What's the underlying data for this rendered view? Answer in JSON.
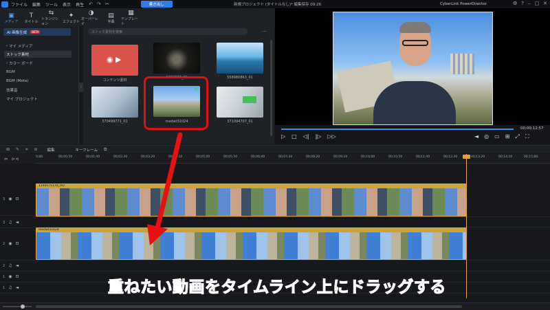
{
  "menubar": {
    "menus": [
      "ファイル",
      "編集",
      "ツール",
      "表示",
      "再生"
    ],
    "toolbar_icons": [
      "undo-icon",
      "redo-icon",
      "cut-icon"
    ],
    "export_label": "書き出し",
    "project_title": "新規プロジェクト (タイトルなし)* 編集保存 09:26",
    "product_name": "CyberLink PowerDirector"
  },
  "ribbon": {
    "tabs": [
      {
        "label": "メディア",
        "icon": "▣"
      },
      {
        "label": "タイトル",
        "icon": "T"
      },
      {
        "label": "トランジション",
        "icon": "⇆"
      },
      {
        "label": "エフェクト",
        "icon": "✦"
      },
      {
        "label": "オーバーレイ",
        "icon": "◑"
      },
      {
        "label": "字幕",
        "icon": "▤"
      },
      {
        "label": "テンプレート",
        "icon": "▦"
      }
    ]
  },
  "leftnav": {
    "ai_button": "AI 画像生成",
    "ai_badge": "BETA",
    "items": [
      "マイ メディア",
      "ストック素材",
      "カラー ボード",
      "BGM",
      "BGM (Meta)",
      "効果音",
      "マイ プロジェクト"
    ],
    "active_index": 1
  },
  "library": {
    "search_placeholder": "ストック素材を検索",
    "more_label": "…",
    "items": [
      {
        "label": "コンテンツ素材",
        "kind": "content"
      },
      {
        "label": "1293306_01",
        "kind": "watch"
      },
      {
        "label": "558980863_01",
        "kind": "sea"
      },
      {
        "label": "370499771_01",
        "kind": "laptop"
      },
      {
        "label": "medwt31024",
        "kind": "ruins",
        "selected": true
      },
      {
        "label": "371094707_01",
        "kind": "tablet"
      }
    ]
  },
  "preview": {
    "timecode": "00;00;12;57",
    "progress": 1.0
  },
  "timeline_toolbar": {
    "edit_label": "編集",
    "keyframe_label": "キーフレーム"
  },
  "ruler": {
    "ticks": [
      "0;00",
      "00;00;50",
      "00;01;40",
      "00;02;30",
      "00;03;20",
      "00;04;10",
      "00;05;00",
      "00;05;50",
      "00;06;40",
      "00;07;30",
      "00;08;20",
      "00;09;10",
      "00;10;00",
      "00;10;50",
      "00;11;40",
      "00;12;30",
      "00;13;20",
      "00;14;10",
      "00;15;00"
    ]
  },
  "tracks": {
    "labels": [
      "3",
      "3",
      "2",
      "2",
      "1",
      "1"
    ],
    "clip_top_name": "1140171170_HD",
    "clip_bottom_name": "medwt31024"
  },
  "annotation": {
    "caption": "重ねたい動画をタイムライン上にドラッグする"
  }
}
